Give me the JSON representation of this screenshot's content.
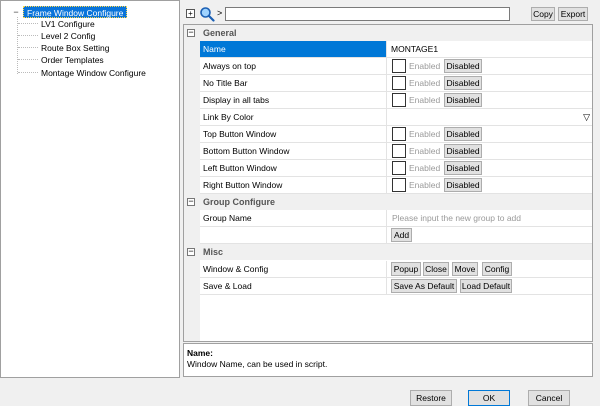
{
  "tree": {
    "root_label": "Frame Window Configure",
    "root_expander": "−",
    "children": [
      "LV1 Configure",
      "Level 2 Config",
      "Route Box Setting",
      "Order Templates",
      "Montage Window Configure"
    ]
  },
  "toolbar": {
    "expand_glyph": "+",
    "path_separator": ">",
    "path_value": "",
    "copy_label": "Copy",
    "export_label": "Export"
  },
  "grid": {
    "general": {
      "label": "General",
      "collapse_glyph": "−",
      "name_label": "Name",
      "name_value": "MONTAGE1",
      "rows": [
        {
          "label": "Always on top",
          "status": "Enabled",
          "button": "Disabled"
        },
        {
          "label": "No Title Bar",
          "status": "Enabled",
          "button": "Disabled"
        },
        {
          "label": "Display in all tabs",
          "status": "Enabled",
          "button": "Disabled"
        }
      ],
      "link_by_color_label": "Link By Color",
      "link_by_color_value": "",
      "dropdown_glyph": "▽",
      "rows2": [
        {
          "label": "Top Button Window",
          "status": "Enabled",
          "button": "Disabled"
        },
        {
          "label": "Bottom Button Window",
          "status": "Enabled",
          "button": "Disabled"
        },
        {
          "label": "Left Button Window",
          "status": "Enabled",
          "button": "Disabled"
        },
        {
          "label": "Right Button Window",
          "status": "Enabled",
          "button": "Disabled"
        }
      ]
    },
    "group_configure": {
      "label": "Group Configure",
      "collapse_glyph": "−",
      "group_name_label": "Group Name",
      "group_name_placeholder": "Please input the new group to add",
      "add_label": "Add"
    },
    "misc": {
      "label": "Misc",
      "collapse_glyph": "−",
      "window_config_label": "Window & Config",
      "window_config_buttons": [
        "Popup",
        "Close",
        "Move",
        "Config"
      ],
      "save_load_label": "Save & Load",
      "save_as_default": "Save As Default",
      "load_default": "Load Default"
    }
  },
  "description": {
    "title": "Name:",
    "text": "Window Name, can be used in script."
  },
  "footer": {
    "restore_label": "Restore",
    "ok_label": "OK",
    "cancel_label": "Cancel"
  },
  "colors": {
    "selection": "#0078d7",
    "tree_selection": "#0a74da",
    "window_bg": "#f0f0f0"
  }
}
